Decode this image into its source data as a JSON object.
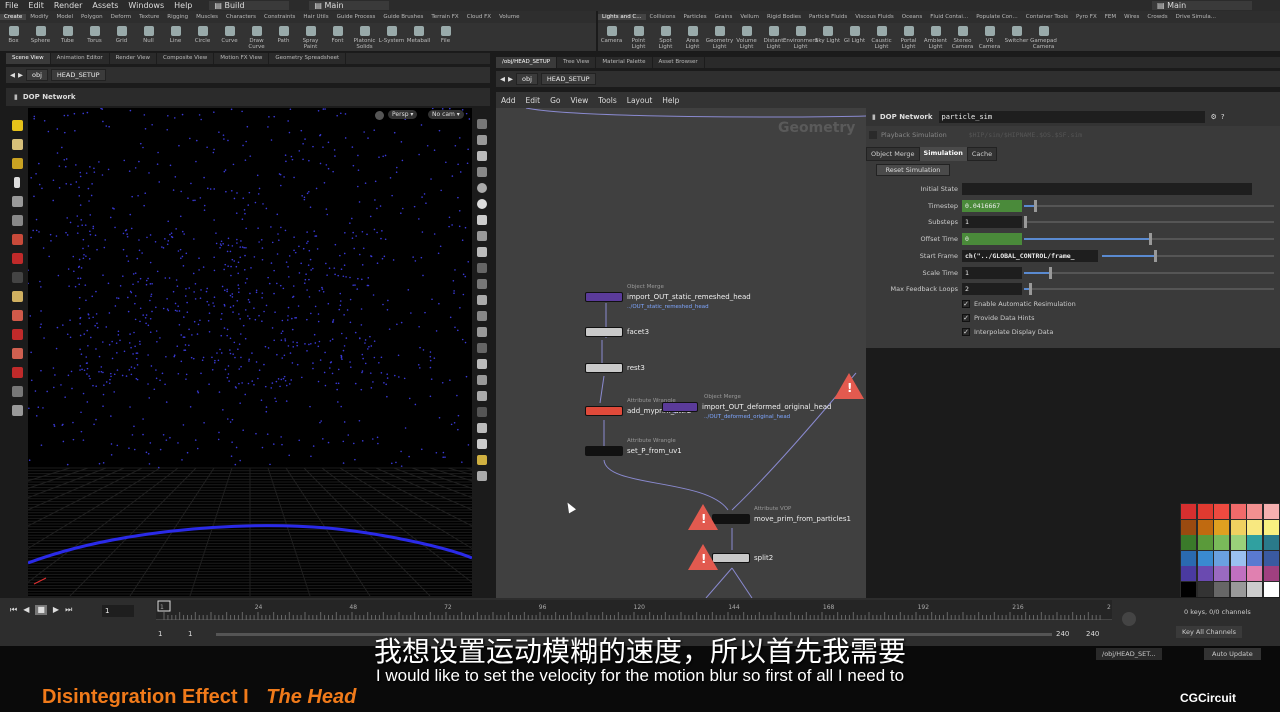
{
  "menu": {
    "items": [
      "File",
      "Edit",
      "Render",
      "Assets",
      "Windows",
      "Help"
    ],
    "desktop": "Build",
    "desktop_right": "Main",
    "desktop_far": "Main"
  },
  "shelf_left": {
    "tabs": [
      "Create",
      "Modify",
      "Model",
      "Polygon",
      "Deform",
      "Texture",
      "Rigging",
      "Muscles",
      "Characters",
      "Constraints",
      "Hair Utils",
      "Guide Process",
      "Guide Brushes",
      "Terrain FX",
      "Cloud FX",
      "Volume"
    ],
    "tools": [
      "Box",
      "Sphere",
      "Tube",
      "Torus",
      "Grid",
      "Null",
      "Line",
      "Circle",
      "Curve",
      "Draw Curve",
      "Path",
      "Spray Paint",
      "Font",
      "Platonic Solids",
      "L-System",
      "Metaball",
      "File"
    ]
  },
  "shelf_right": {
    "tabs": [
      "Lights and C...",
      "Collisions",
      "Particles",
      "Grains",
      "Vellum",
      "Rigid Bodies",
      "Particle Fluids",
      "Viscous Fluids",
      "Oceans",
      "Fluid Contai...",
      "Populate Con...",
      "Container Tools",
      "Pyro FX",
      "FEM",
      "Wires",
      "Crowds",
      "Drive Simula..."
    ],
    "tools": [
      "Camera",
      "Point Light",
      "Spot Light",
      "Area Light",
      "Geometry Light",
      "Volume Light",
      "Distant Light",
      "Environment Light",
      "Sky Light",
      "GI Light",
      "Caustic Light",
      "Portal Light",
      "Ambient Light",
      "Stereo Camera",
      "VR Camera",
      "Switcher",
      "Gamepad Camera"
    ]
  },
  "left_pane": {
    "tabs": [
      "Scene View",
      "Animation Editor",
      "Render View",
      "Composite View",
      "Motion FX View",
      "Geometry Spreadsheet"
    ],
    "path": [
      "obj",
      "HEAD_SETUP"
    ],
    "title": "DOP Network",
    "persp": "Persp",
    "cam": "No cam"
  },
  "right_pane": {
    "tabs": [
      "/obj/HEAD_SETUP",
      "Tree View",
      "Material Palette",
      "Asset Browser"
    ],
    "path": [
      "obj",
      "HEAD_SETUP"
    ],
    "menu": [
      "Add",
      "Edit",
      "Go",
      "View",
      "Tools",
      "Layout",
      "Help"
    ],
    "watermark": "Geometry"
  },
  "nodes": [
    {
      "type": "Object Merge",
      "name": "import_OUT_static_remeshed_head",
      "sub": "../OUT_static_remeshed_head",
      "color": "#5b3b9a"
    },
    {
      "type": "",
      "name": "facet3",
      "sub": "",
      "color": "#c9c9c9"
    },
    {
      "type": "",
      "name": "rest3",
      "sub": "",
      "color": "#c9c9c9"
    },
    {
      "type": "Attribute Wrangle",
      "name": "add_myprim_attr2",
      "sub": "",
      "color": "#e04a3a"
    },
    {
      "type": "Object Merge",
      "name": "import_OUT_deformed_original_head",
      "sub": "../OUT_deformed_original_head",
      "color": "#5b3b9a"
    },
    {
      "type": "Attribute Wrangle",
      "name": "set_P_from_uv1",
      "sub": "",
      "color": "#111111"
    },
    {
      "type": "Attribute VOP",
      "name": "move_prim_from_particles1",
      "sub": "",
      "color": "#111111"
    },
    {
      "type": "",
      "name": "split2",
      "sub": "",
      "color": "#c9c9c9"
    }
  ],
  "params": {
    "node_type": "DOP Network",
    "node_name": "particle_sim",
    "playback_label": "Playback Simulation",
    "path_hint": "$HIP/sim/$HIPNAME.$OS.$SF.sim",
    "tabs": [
      "Object Merge",
      "Simulation",
      "Cache"
    ],
    "reset": "Reset Simulation",
    "rows": [
      {
        "label": "Initial State",
        "value": ""
      },
      {
        "label": "Timestep",
        "value": "0.0416667",
        "level": 0.04
      },
      {
        "label": "Substeps",
        "value": "1",
        "level": 0.0
      },
      {
        "label": "Offset Time",
        "value": "0",
        "level": 0.5
      },
      {
        "label": "Start Frame",
        "value": "ch(\"../GLOBAL_CONTROL/frame_",
        "level": 0.3
      },
      {
        "label": "Scale Time",
        "value": "1",
        "level": 0.1
      },
      {
        "label": "Max Feedback Loops",
        "value": "2",
        "level": 0.02
      }
    ],
    "checks": [
      "Enable Automatic Resimulation",
      "Provide Data Hints",
      "Interpolate Display Data"
    ]
  },
  "timeline": {
    "frame": "1",
    "ticks": [
      "1",
      "24",
      "48",
      "72",
      "96",
      "120",
      "144",
      "168",
      "192",
      "216",
      "2"
    ],
    "start": "1",
    "start2": "1",
    "end": "240",
    "end2": "240",
    "keys": "0 keys, 0/0 channels",
    "channels": "Key All Channels",
    "auto": "Auto Update",
    "netpath": "/obj/HEAD_SET..."
  },
  "subtitles": {
    "zh": "我想设置运动模糊的速度，所以首先我需要",
    "en": "I would like to set the velocity for the motion blur so first of all I need to"
  },
  "course": {
    "title": "Disintegration Effect I",
    "part": "The Head",
    "brand": "CGCircuit"
  },
  "palette": [
    "#d62f2f",
    "#e03a30",
    "#ee4a40",
    "#f06a6a",
    "#f29090",
    "#f5b0b0",
    "#9a4a10",
    "#c06a10",
    "#e0a020",
    "#f0d060",
    "#f8e880",
    "#f8f080",
    "#3a7a2a",
    "#5a9a3a",
    "#7aba5a",
    "#9ad07a",
    "#30a0a0",
    "#2a7a8a",
    "#2a6ab0",
    "#3a8ad0",
    "#6aa0e0",
    "#9ac0f0",
    "#5a7ad0",
    "#3a5aa0",
    "#4a3aa0",
    "#6a4ab0",
    "#9a6ac0",
    "#c070c0",
    "#e080b0",
    "#a04080",
    "#000000",
    "#333333",
    "#666666",
    "#999999",
    "#cccccc",
    "#ffffff"
  ]
}
